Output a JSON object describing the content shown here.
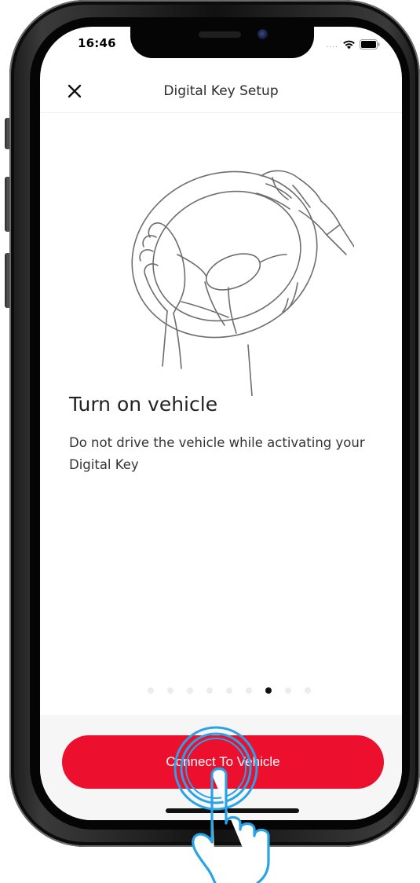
{
  "status_bar": {
    "time": "16:46",
    "signal_dots": "....",
    "icons": [
      "wifi-icon",
      "battery-icon"
    ]
  },
  "header": {
    "title": "Digital Key Setup",
    "close_icon": "close-icon"
  },
  "content": {
    "illustration": "steering-wheel-hands-illustration",
    "heading": "Turn on vehicle",
    "body": "Do not drive the vehicle while activating your Digital Key"
  },
  "pager": {
    "total": 9,
    "active_index": 6
  },
  "cta": {
    "label": "Connect To Vehicle"
  },
  "colors": {
    "accent": "#ec0f2e",
    "text": "#222222",
    "touch_indicator": "#2aa3e6"
  }
}
